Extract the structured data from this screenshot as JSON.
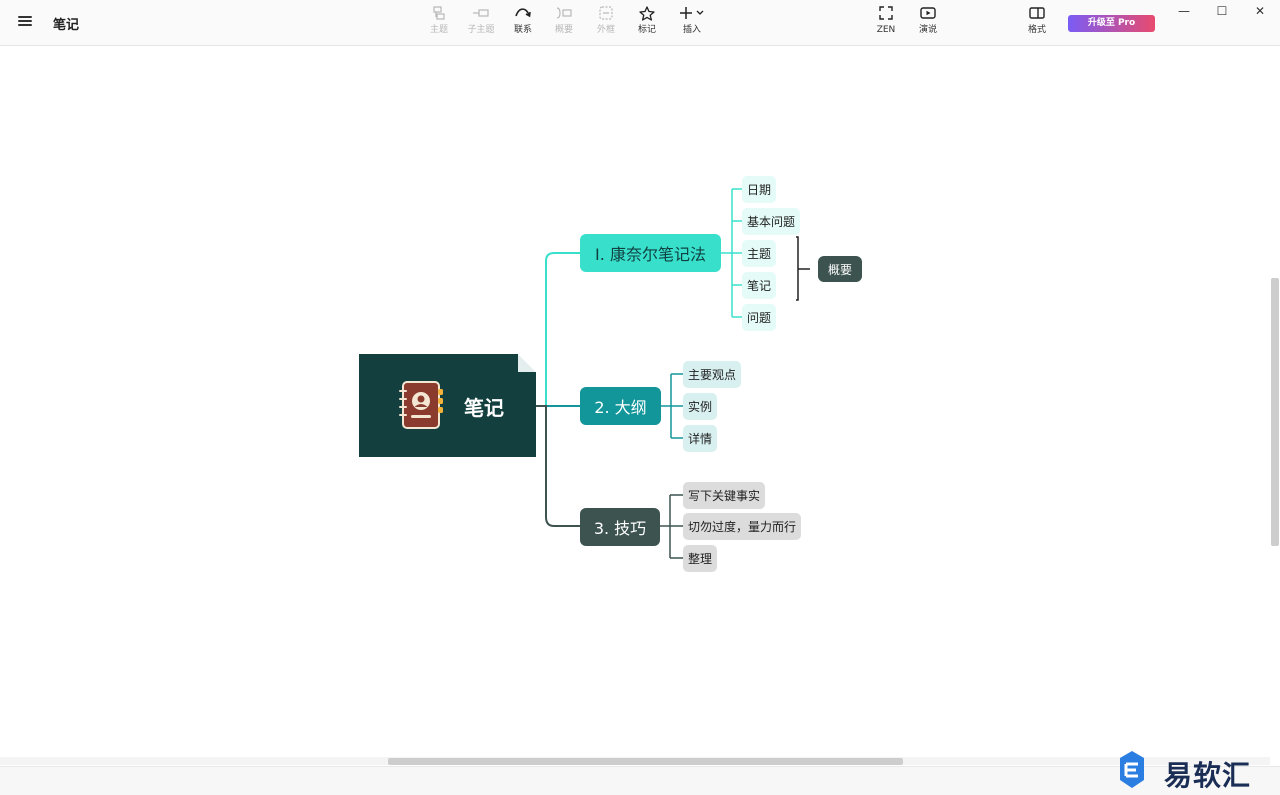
{
  "header": {
    "doc_title": "笔记",
    "tools": [
      {
        "label": "主题",
        "icon": "topic-icon",
        "enabled": false
      },
      {
        "label": "子主题",
        "icon": "subtopic-icon",
        "enabled": false
      },
      {
        "label": "联系",
        "icon": "relationship-icon",
        "enabled": true
      },
      {
        "label": "概要",
        "icon": "summary-icon",
        "enabled": false
      },
      {
        "label": "外框",
        "icon": "boundary-icon",
        "enabled": false
      },
      {
        "label": "标记",
        "icon": "star-icon",
        "enabled": true
      },
      {
        "label": "插入",
        "icon": "plus-icon",
        "enabled": true
      }
    ],
    "zen_label": "ZEN",
    "present_label": "演说",
    "format_label": "格式",
    "pro_label": "升级至 Pro"
  },
  "mindmap": {
    "root": "笔记",
    "branches": [
      {
        "label": "I. 康奈尔笔记法",
        "children": [
          "日期",
          "基本问题",
          "主题",
          "笔记",
          "问题"
        ]
      },
      {
        "label": "2. 大纲",
        "children": [
          "主要观点",
          "实例",
          "详情"
        ]
      },
      {
        "label": "3. 技巧",
        "children": [
          "写下关键事实",
          "切勿过度，量力而行",
          "整理"
        ]
      }
    ],
    "summary_label": "概要"
  },
  "watermark": "易软汇",
  "colors": {
    "root": "#13403f",
    "branch1": "#38e0cb",
    "branch2": "#12969a",
    "branch3": "#3c5350",
    "pro_gradient_start": "#7a5cf5",
    "pro_gradient_end": "#e84b6e"
  }
}
